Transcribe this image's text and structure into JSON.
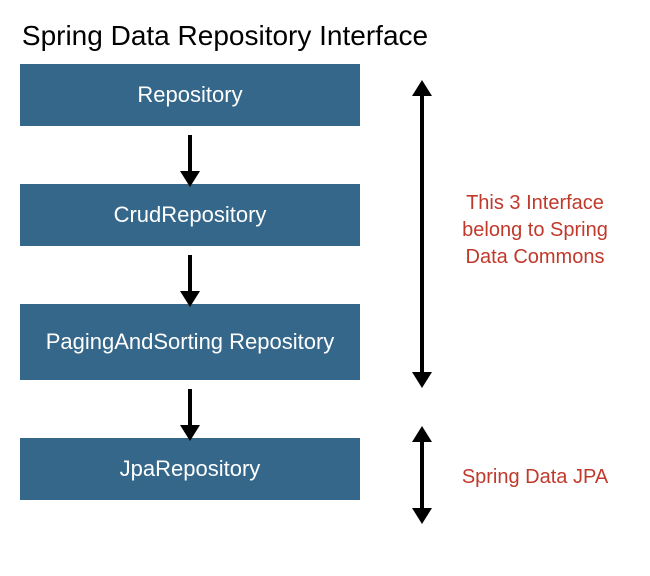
{
  "title": "Spring Data Repository Interface",
  "boxes": {
    "repository": "Repository",
    "crud": "CrudRepository",
    "paging": "PagingAndSorting Repository",
    "jpa": "JpaRepository"
  },
  "annotations": {
    "commons": "This 3 Interface belong to Spring Data Commons",
    "jpa": "Spring Data JPA"
  },
  "colors": {
    "box_bg": "#34678a",
    "box_text": "#ffffff",
    "annotation_text": "#c0392b"
  }
}
